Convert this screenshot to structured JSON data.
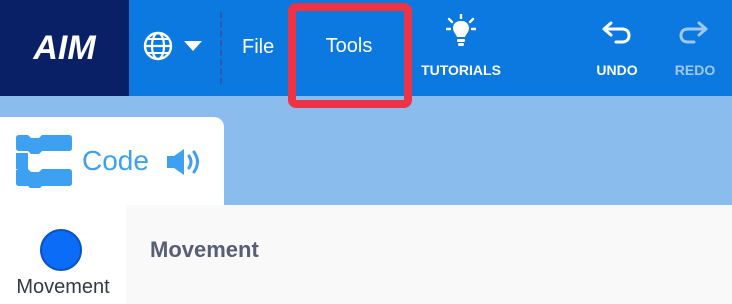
{
  "header": {
    "logo_text": "AIM",
    "language_icon": "globe-icon",
    "menu": {
      "file_label": "File",
      "tools_label": "Tools"
    },
    "tutorials_label": "TUTORIALS",
    "tutorials_icon": "lightbulb-icon",
    "undo_label": "UNDO",
    "undo_icon": "undo-arrow-icon",
    "redo_label": "REDO",
    "redo_icon": "redo-arrow-icon",
    "highlight_color": "#ee3345"
  },
  "tabs": {
    "code_label": "Code",
    "code_icon": "code-blocks-icon",
    "sound_icon": "speaker-icon"
  },
  "categories": [
    {
      "label": "Movement",
      "color": "#0a6cf7"
    }
  ],
  "workspace": {
    "section_title": "Movement"
  },
  "colors": {
    "menu_bar": "#0c79e0",
    "logo_bg": "#0a2066",
    "tab_area": "#8bbcee"
  }
}
